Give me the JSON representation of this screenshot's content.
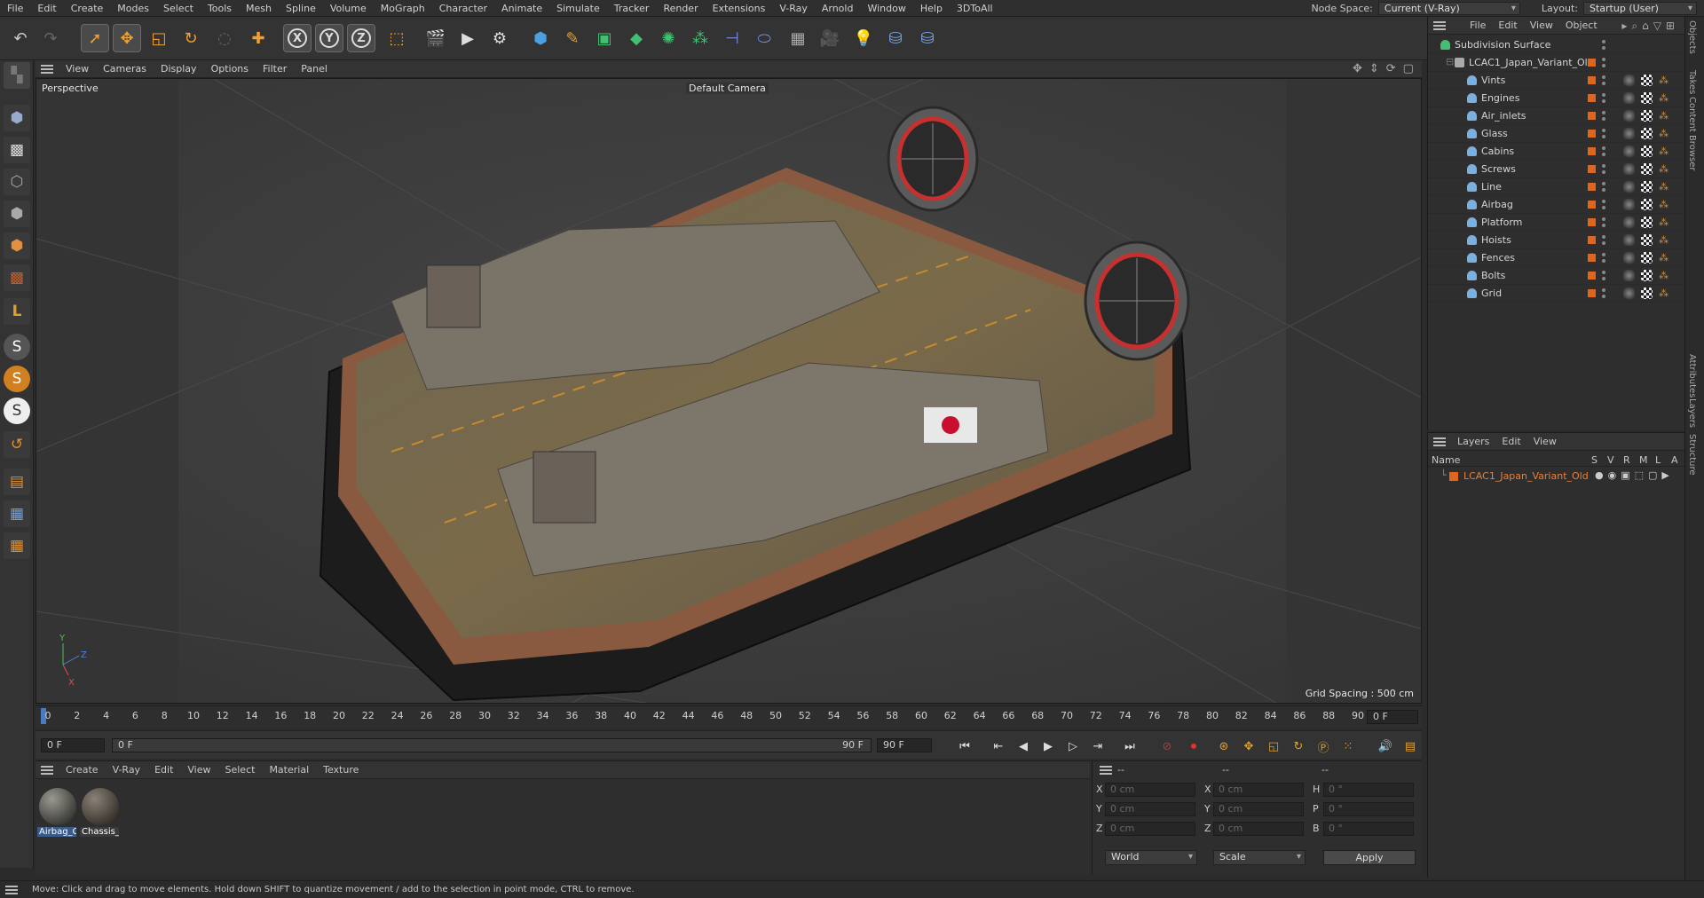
{
  "menu": [
    "File",
    "Edit",
    "Create",
    "Modes",
    "Select",
    "Tools",
    "Mesh",
    "Spline",
    "Volume",
    "MoGraph",
    "Character",
    "Animate",
    "Simulate",
    "Tracker",
    "Render",
    "Extensions",
    "V-Ray",
    "Arnold",
    "Window",
    "Help",
    "3DToAll"
  ],
  "node_space": {
    "label": "Node Space:",
    "value": "Current (V-Ray)"
  },
  "layout": {
    "label": "Layout:",
    "value": "Startup (User)"
  },
  "axis_buttons": {
    "x": "X",
    "y": "Y",
    "z": "Z"
  },
  "viewport_menu": [
    "View",
    "Cameras",
    "Display",
    "Options",
    "Filter",
    "Panel"
  ],
  "viewport": {
    "name": "Perspective",
    "camera": "Default Camera",
    "grid_spacing": "Grid Spacing : 500 cm",
    "flag_color": "#c8102e"
  },
  "timeline": {
    "ticks": [
      "0",
      "2",
      "4",
      "6",
      "8",
      "10",
      "12",
      "14",
      "16",
      "18",
      "20",
      "22",
      "24",
      "26",
      "28",
      "30",
      "32",
      "34",
      "36",
      "38",
      "40",
      "42",
      "44",
      "46",
      "48",
      "50",
      "52",
      "54",
      "56",
      "58",
      "60",
      "62",
      "64",
      "66",
      "68",
      "70",
      "72",
      "74",
      "76",
      "78",
      "80",
      "82",
      "84",
      "86",
      "88",
      "90"
    ],
    "current": "0 F"
  },
  "playback": {
    "start": "0 F",
    "current": "0 F",
    "end_slider": "90 F",
    "end": "90 F"
  },
  "material_menu": [
    "Create",
    "V-Ray",
    "Edit",
    "View",
    "Select",
    "Material",
    "Texture"
  ],
  "materials": [
    {
      "label": "Airbag_C"
    },
    {
      "label": "Chassis_"
    }
  ],
  "coords": {
    "header": [
      "--",
      "--",
      "--"
    ],
    "rows": [
      {
        "a": "X",
        "av": "0 cm",
        "b": "X",
        "bv": "0 cm",
        "c": "H",
        "cv": "0 °"
      },
      {
        "a": "Y",
        "av": "0 cm",
        "b": "Y",
        "bv": "0 cm",
        "c": "P",
        "cv": "0 °"
      },
      {
        "a": "Z",
        "av": "0 cm",
        "b": "Z",
        "bv": "0 cm",
        "c": "B",
        "cv": "0 °"
      }
    ],
    "space": "World",
    "mode": "Scale",
    "apply": "Apply"
  },
  "object_menu": [
    "File",
    "Edit",
    "View",
    "Object"
  ],
  "objects": {
    "root": "Subdivision Surface",
    "group": "LCAC1_Japan_Variant_Old",
    "children": [
      "Vints",
      "Engines",
      "Air_inlets",
      "Glass",
      "Cabins",
      "Screws",
      "Line",
      "Airbag",
      "Platform",
      "Hoists",
      "Fences",
      "Bolts",
      "Grid"
    ]
  },
  "layers": {
    "menu": [
      "Layers",
      "Edit",
      "View"
    ],
    "columns": {
      "name": "Name",
      "flags": [
        "S",
        "V",
        "R",
        "M",
        "L",
        "A"
      ]
    },
    "items": [
      "LCAC1_Japan_Variant_Old"
    ]
  },
  "side_tabs": [
    "Objects",
    "Takes",
    "Content Browser",
    "Attributes",
    "Layers",
    "Structure"
  ],
  "status": "Move: Click and drag to move elements. Hold down SHIFT to quantize movement / add to the selection in point mode, CTRL to remove."
}
